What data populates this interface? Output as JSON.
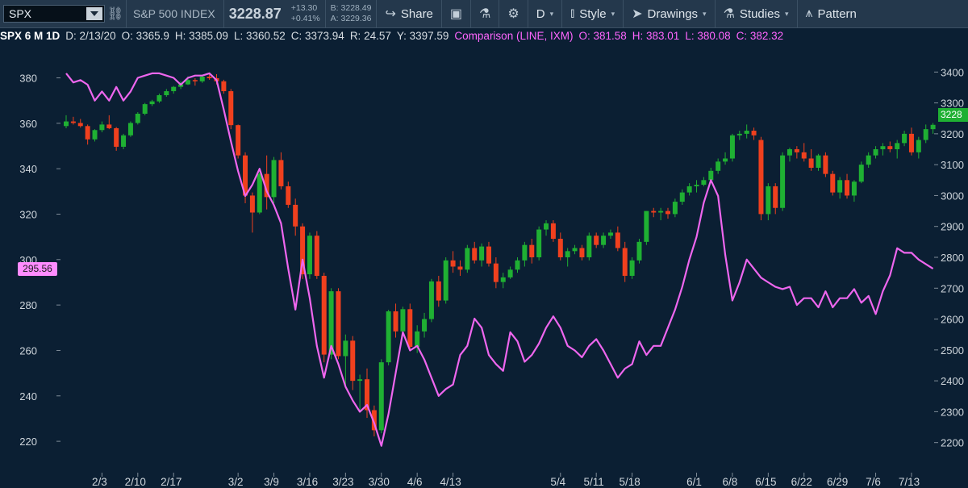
{
  "toolbar": {
    "symbol": "SPX",
    "instrument_name": "S&P 500 INDEX",
    "last_price": "3228.87",
    "net_change": "+13.30",
    "pct_change": "+0.41%",
    "bid": "B: 3228.49",
    "ask": "A: 3229.36",
    "share_label": "Share",
    "aggregation_label": "D",
    "style_label": "Style",
    "drawings_label": "Drawings",
    "studies_label": "Studies",
    "patterns_label": "Pattern"
  },
  "infobar": {
    "title": "SPX 6 M 1D",
    "date": "D: 2/13/20",
    "open": "O: 3365.9",
    "high": "H: 3385.09",
    "low": "L: 3360.52",
    "close": "C: 3373.94",
    "range": "R: 24.57",
    "y": "Y: 3397.59",
    "comparison_label": "Comparison (LINE, IXM)",
    "comp_open": "O: 381.58",
    "comp_high": "H: 383.01",
    "comp_low": "L: 380.08",
    "comp_close": "C: 382.32"
  },
  "badges": {
    "right_price": "3228",
    "left_price": "295.56"
  },
  "colors": {
    "background": "#0b1f33",
    "toolbar": "#24384c",
    "up_candle": "#1fb033",
    "down_candle": "#f0401e",
    "comparison_line": "#ee66ee",
    "last_price_badge": "#1fb033",
    "comparison_badge": "#ff8cff"
  },
  "icons": [
    "dropdown-caret-icon",
    "link-icon",
    "share-icon",
    "alert-icon",
    "flask-icon",
    "gear-icon",
    "style-icon",
    "cursor-icon",
    "studies-flask-icon",
    "pattern-icon"
  ],
  "chart_data": {
    "type": "candlestick",
    "symbol": "SPX",
    "period": "6 M",
    "interval": "1D",
    "x_tick_labels": [
      "2/3",
      "2/10",
      "2/17",
      "3/2",
      "3/9",
      "3/16",
      "3/23",
      "3/30",
      "4/6",
      "4/13",
      "5/4",
      "5/11",
      "5/18",
      "6/1",
      "6/8",
      "6/15",
      "6/22",
      "6/29",
      "7/6",
      "7/13"
    ],
    "price_axis_ticks": [
      2200,
      2300,
      2400,
      2500,
      2600,
      2700,
      2800,
      2900,
      3000,
      3100,
      3200,
      3300,
      3400
    ],
    "price_ylim": [
      2160,
      3440
    ],
    "comparison_axis_ticks": [
      220,
      240,
      260,
      280,
      300,
      320,
      340,
      360,
      380
    ],
    "comparison_ylim": [
      214,
      388
    ],
    "grid": false,
    "series": [
      {
        "name": "SPX",
        "kind": "ohlc",
        "values": [
          [
            3225,
            3260,
            3218,
            3240
          ],
          [
            3240,
            3255,
            3230,
            3235
          ],
          [
            3235,
            3248,
            3220,
            3225
          ],
          [
            3225,
            3230,
            3165,
            3182
          ],
          [
            3182,
            3215,
            3175,
            3212
          ],
          [
            3212,
            3240,
            3205,
            3230
          ],
          [
            3230,
            3260,
            3215,
            3218
          ],
          [
            3218,
            3222,
            3145,
            3158
          ],
          [
            3158,
            3200,
            3150,
            3195
          ],
          [
            3195,
            3240,
            3190,
            3235
          ],
          [
            3235,
            3270,
            3230,
            3265
          ],
          [
            3265,
            3300,
            3260,
            3296
          ],
          [
            3296,
            3310,
            3290,
            3305
          ],
          [
            3305,
            3330,
            3300,
            3325
          ],
          [
            3325,
            3345,
            3320,
            3338
          ],
          [
            3338,
            3355,
            3330,
            3352
          ],
          [
            3352,
            3370,
            3345,
            3360
          ],
          [
            3360,
            3386,
            3358,
            3374
          ],
          [
            3374,
            3380,
            3356,
            3370
          ],
          [
            3370,
            3390,
            3365,
            3385
          ],
          [
            3385,
            3393,
            3375,
            3380
          ],
          [
            3380,
            3393,
            3360,
            3370
          ],
          [
            3370,
            3375,
            3330,
            3338
          ],
          [
            3338,
            3345,
            3215,
            3228
          ],
          [
            3228,
            3230,
            3120,
            3130
          ],
          [
            3130,
            3140,
            2975,
            3000
          ],
          [
            3000,
            3010,
            2880,
            2945
          ],
          [
            2945,
            3075,
            2940,
            3070
          ],
          [
            3070,
            3130,
            2955,
            2995
          ],
          [
            2995,
            3125,
            2975,
            3115
          ],
          [
            3115,
            3140,
            3020,
            3030
          ],
          [
            3030,
            3045,
            2960,
            2970
          ],
          [
            2970,
            2990,
            2870,
            2900
          ],
          [
            2900,
            2910,
            2730,
            2745
          ],
          [
            2745,
            2880,
            2730,
            2870
          ],
          [
            2870,
            2885,
            2730,
            2740
          ],
          [
            2740,
            2750,
            2460,
            2485
          ],
          [
            2485,
            2700,
            2470,
            2690
          ],
          [
            2690,
            2700,
            2470,
            2480
          ],
          [
            2480,
            2550,
            2380,
            2530
          ],
          [
            2530,
            2545,
            2370,
            2400
          ],
          [
            2400,
            2420,
            2300,
            2405
          ],
          [
            2405,
            2440,
            2280,
            2305
          ],
          [
            2305,
            2320,
            2220,
            2240
          ],
          [
            2240,
            2470,
            2230,
            2460
          ],
          [
            2460,
            2630,
            2450,
            2625
          ],
          [
            2625,
            2650,
            2540,
            2560
          ],
          [
            2560,
            2640,
            2550,
            2632
          ],
          [
            2632,
            2650,
            2500,
            2510
          ],
          [
            2510,
            2580,
            2490,
            2560
          ],
          [
            2560,
            2620,
            2540,
            2600
          ],
          [
            2600,
            2730,
            2590,
            2722
          ],
          [
            2722,
            2740,
            2640,
            2660
          ],
          [
            2660,
            2800,
            2650,
            2790
          ],
          [
            2790,
            2820,
            2750,
            2770
          ],
          [
            2770,
            2790,
            2740,
            2760
          ],
          [
            2760,
            2840,
            2750,
            2830
          ],
          [
            2830,
            2850,
            2780,
            2790
          ],
          [
            2790,
            2845,
            2770,
            2835
          ],
          [
            2835,
            2850,
            2770,
            2780
          ],
          [
            2780,
            2800,
            2700,
            2720
          ],
          [
            2720,
            2750,
            2700,
            2735
          ],
          [
            2735,
            2770,
            2730,
            2760
          ],
          [
            2760,
            2800,
            2750,
            2790
          ],
          [
            2790,
            2850,
            2770,
            2840
          ],
          [
            2840,
            2860,
            2780,
            2800
          ],
          [
            2800,
            2900,
            2790,
            2890
          ],
          [
            2890,
            2920,
            2870,
            2910
          ],
          [
            2910,
            2920,
            2850,
            2860
          ],
          [
            2860,
            2880,
            2790,
            2800
          ],
          [
            2800,
            2830,
            2770,
            2820
          ],
          [
            2820,
            2840,
            2810,
            2830
          ],
          [
            2830,
            2840,
            2790,
            2800
          ],
          [
            2800,
            2880,
            2790,
            2870
          ],
          [
            2870,
            2880,
            2830,
            2840
          ],
          [
            2840,
            2880,
            2830,
            2870
          ],
          [
            2870,
            2890,
            2860,
            2880
          ],
          [
            2880,
            2900,
            2820,
            2830
          ],
          [
            2830,
            2850,
            2720,
            2740
          ],
          [
            2740,
            2800,
            2730,
            2790
          ],
          [
            2790,
            2860,
            2780,
            2850
          ],
          [
            2850,
            2950,
            2840,
            2950
          ],
          [
            2950,
            2960,
            2930,
            2945
          ],
          [
            2945,
            2960,
            2920,
            2950
          ],
          [
            2950,
            2960,
            2925,
            2940
          ],
          [
            2940,
            2990,
            2930,
            2980
          ],
          [
            2980,
            3020,
            2970,
            3010
          ],
          [
            3010,
            3040,
            3000,
            3030
          ],
          [
            3030,
            3050,
            3010,
            3035
          ],
          [
            3035,
            3060,
            3030,
            3050
          ],
          [
            3050,
            3090,
            3040,
            3080
          ],
          [
            3080,
            3120,
            3070,
            3110
          ],
          [
            3110,
            3140,
            3100,
            3120
          ],
          [
            3120,
            3200,
            3110,
            3195
          ],
          [
            3195,
            3210,
            3180,
            3200
          ],
          [
            3200,
            3230,
            3185,
            3210
          ],
          [
            3210,
            3220,
            3180,
            3195
          ],
          [
            3180,
            3190,
            2920,
            2940
          ],
          [
            2940,
            3040,
            2920,
            3030
          ],
          [
            3030,
            3040,
            2940,
            2960
          ],
          [
            2960,
            3140,
            2950,
            3130
          ],
          [
            3130,
            3155,
            3110,
            3150
          ],
          [
            3150,
            3160,
            3120,
            3140
          ],
          [
            3140,
            3170,
            3110,
            3120
          ],
          [
            3120,
            3150,
            3080,
            3090
          ],
          [
            3090,
            3135,
            3080,
            3130
          ],
          [
            3130,
            3140,
            3060,
            3070
          ],
          [
            3070,
            3080,
            3000,
            3010
          ],
          [
            3010,
            3060,
            2990,
            3050
          ],
          [
            3050,
            3070,
            2990,
            3000
          ],
          [
            3000,
            3050,
            2980,
            3045
          ],
          [
            3045,
            3110,
            3040,
            3100
          ],
          [
            3100,
            3140,
            3090,
            3130
          ],
          [
            3130,
            3160,
            3120,
            3150
          ],
          [
            3150,
            3170,
            3130,
            3160
          ],
          [
            3160,
            3175,
            3140,
            3150
          ],
          [
            3150,
            3180,
            3120,
            3170
          ],
          [
            3170,
            3210,
            3160,
            3200
          ],
          [
            3200,
            3220,
            3130,
            3140
          ],
          [
            3140,
            3190,
            3120,
            3180
          ],
          [
            3180,
            3230,
            3170,
            3215
          ],
          [
            3215,
            3235,
            3200,
            3229
          ]
        ]
      },
      {
        "name": "Comparison (LINE, IXM)",
        "kind": "line",
        "values": [
          382,
          378,
          379,
          377,
          370,
          374,
          370,
          376,
          370,
          374,
          380,
          381,
          382,
          382,
          381,
          380,
          377,
          380,
          381,
          381,
          382,
          379,
          366,
          352,
          339,
          328,
          333,
          340,
          330,
          324,
          316,
          296,
          278,
          300,
          283,
          262,
          248,
          262,
          254,
          244,
          238,
          233,
          236,
          228,
          218,
          232,
          250,
          268,
          260,
          262,
          256,
          248,
          240,
          243,
          245,
          258,
          262,
          274,
          270,
          258,
          254,
          251,
          268,
          264,
          255,
          258,
          263,
          270,
          275,
          270,
          262,
          260,
          257,
          262,
          265,
          260,
          254,
          248,
          252,
          254,
          264,
          258,
          262,
          262,
          270,
          278,
          288,
          300,
          310,
          325,
          335,
          328,
          302,
          282,
          290,
          300,
          296,
          292,
          290,
          288,
          287,
          288,
          280,
          283,
          283,
          279,
          286,
          279,
          283,
          283,
          287,
          281,
          284,
          276,
          286,
          293,
          305,
          303,
          303,
          300,
          298,
          296
        ]
      }
    ]
  }
}
